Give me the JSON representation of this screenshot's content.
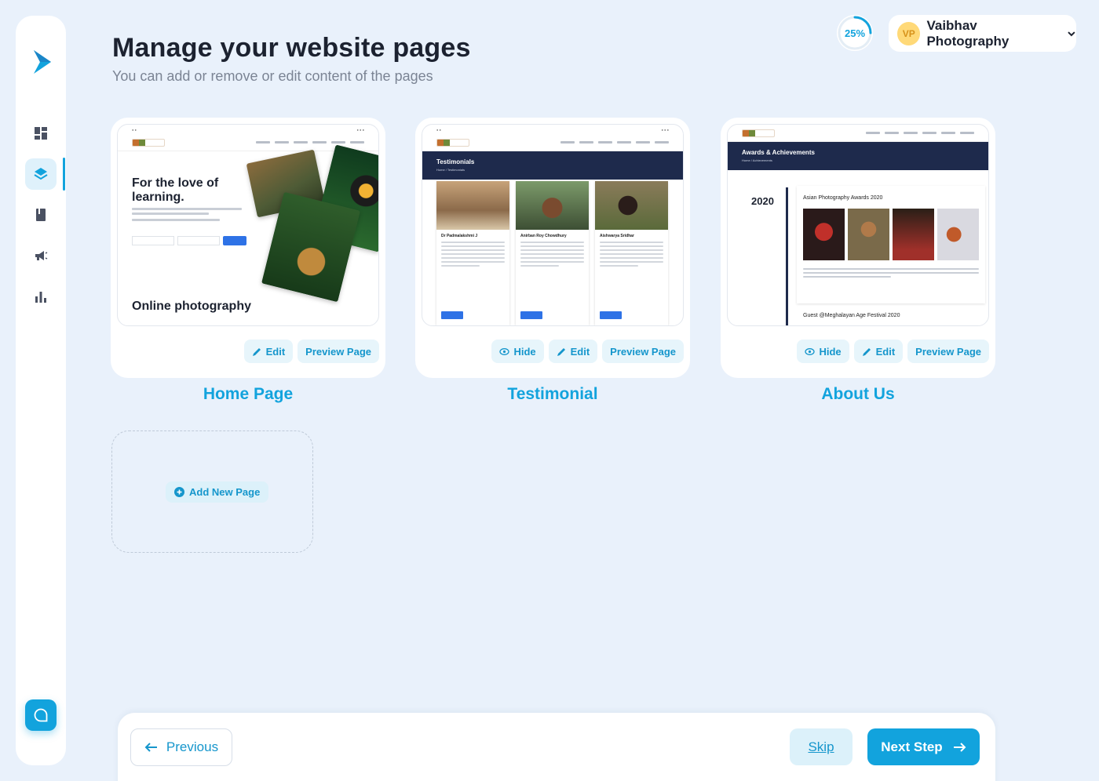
{
  "header": {
    "title": "Manage your website pages",
    "subtitle": "You can add or remove or edit content of the pages"
  },
  "progress": {
    "label": "25%",
    "value": 0.25
  },
  "account": {
    "initials": "VP",
    "name": "Vaibhav Photography"
  },
  "sidebar": {
    "items": [
      {
        "icon": "dashboard-icon",
        "active": false
      },
      {
        "icon": "layers-icon",
        "active": true
      },
      {
        "icon": "book-icon",
        "active": false
      },
      {
        "icon": "megaphone-icon",
        "active": false
      },
      {
        "icon": "bar-chart-icon",
        "active": false
      }
    ],
    "chat_icon": "chat-icon"
  },
  "pages": [
    {
      "title": "Home Page",
      "actions": [
        "Edit",
        "Preview Page"
      ],
      "preview": {
        "hero_heading": "For the love of learning.",
        "hero_footer": "Online photography"
      }
    },
    {
      "title": "Testimonial",
      "actions": [
        "Hide",
        "Edit",
        "Preview Page"
      ],
      "preview": {
        "banner_title": "Testimonials",
        "breadcrumb": "Home  /  Testimonials",
        "people": [
          "Dr Padmalakshmi J",
          "Anirban Roy Chowdhury",
          "Aishwarya Sridhar"
        ]
      }
    },
    {
      "title": "About Us",
      "actions": [
        "Hide",
        "Edit",
        "Preview Page"
      ],
      "preview": {
        "banner_title": "Awards & Achievements",
        "breadcrumb": "Home  /  Achievements",
        "year": "2020",
        "award": "Asian Photography Awards 2020",
        "next_item": "Guest @Meghalayan Age Festival 2020"
      }
    }
  ],
  "add_page": {
    "label": "Add New Page"
  },
  "footer": {
    "previous": "Previous",
    "skip": "Skip",
    "next": "Next Step"
  },
  "colors": {
    "accent": "#12a3dd",
    "background": "#e9f1fb",
    "navy": "#1e2a4c"
  }
}
